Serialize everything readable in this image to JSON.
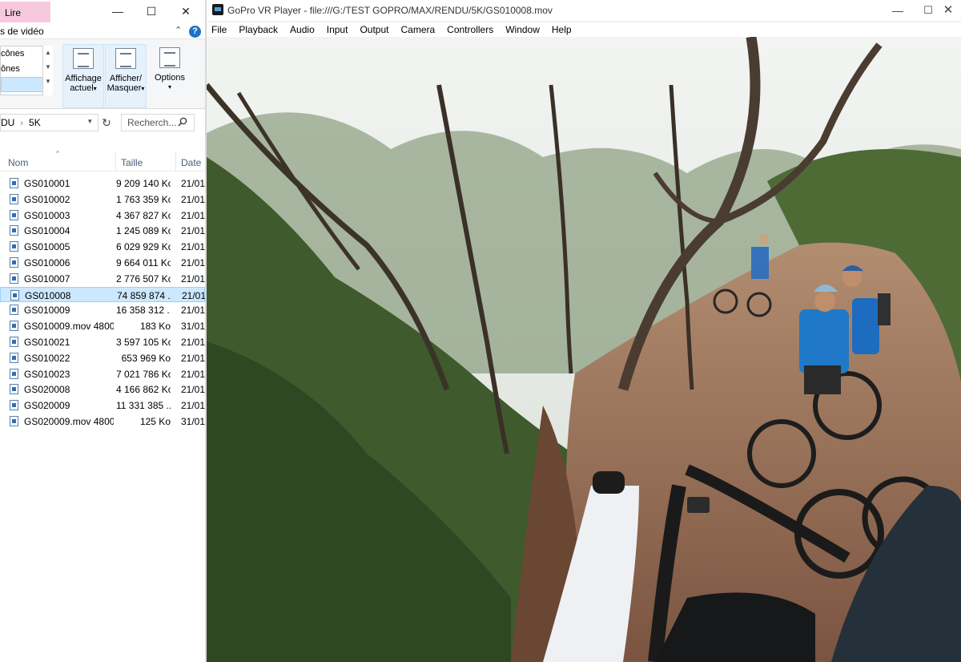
{
  "explorer": {
    "ribbon_tab": "Lire",
    "subtab_label": "s de vidéo",
    "window_controls": {
      "minimize": "—",
      "maximize": "☐",
      "close": "✕"
    },
    "help_glyph": "?",
    "layout_options": [
      "cônes",
      "ônes",
      ""
    ],
    "ribbon_buttons": {
      "affichage_line1": "Affichage",
      "affichage_line2": "actuel",
      "afficher_line1": "Afficher/",
      "afficher_line2": "Masquer",
      "options": "Options"
    },
    "address": {
      "part1": "DU",
      "separator": "›",
      "part2": "5K"
    },
    "search_placeholder": "Recherch...",
    "columns": {
      "name": "Nom",
      "size": "Taille",
      "date": "Date"
    },
    "files": [
      {
        "name": "GS010001",
        "size": "9 209 140 Ko",
        "date": "21/01",
        "selected": false
      },
      {
        "name": "GS010002",
        "size": "1 763 359 Ko",
        "date": "21/01",
        "selected": false
      },
      {
        "name": "GS010003",
        "size": "4 367 827 Ko",
        "date": "21/01",
        "selected": false
      },
      {
        "name": "GS010004",
        "size": "1 245 089 Ko",
        "date": "21/01",
        "selected": false
      },
      {
        "name": "GS010005",
        "size": "6 029 929 Ko",
        "date": "21/01",
        "selected": false
      },
      {
        "name": "GS010006",
        "size": "9 664 011 Ko",
        "date": "21/01",
        "selected": false
      },
      {
        "name": "GS010007",
        "size": "2 776 507 Ko",
        "date": "21/01",
        "selected": false
      },
      {
        "name": "GS010008",
        "size": "74 859 874 ...",
        "date": "21/01",
        "selected": true
      },
      {
        "name": "GS010009",
        "size": "16 358 312 ...",
        "date": "21/01",
        "selected": false
      },
      {
        "name": "GS010009.mov 4800...",
        "size": "183 Ko",
        "date": "31/01",
        "selected": false
      },
      {
        "name": "GS010021",
        "size": "3 597 105 Ko",
        "date": "21/01",
        "selected": false
      },
      {
        "name": "GS010022",
        "size": "653 969 Ko",
        "date": "21/01",
        "selected": false
      },
      {
        "name": "GS010023",
        "size": "7 021 786 Ko",
        "date": "21/01",
        "selected": false
      },
      {
        "name": "GS020008",
        "size": "4 166 862 Ko",
        "date": "21/01",
        "selected": false
      },
      {
        "name": "GS020009",
        "size": "11 331 385 ...",
        "date": "21/01",
        "selected": false
      },
      {
        "name": "GS020009.mov 4800...",
        "size": "125 Ko",
        "date": "31/01",
        "selected": false
      }
    ]
  },
  "player": {
    "title": "GoPro VR Player - file:///G:/TEST GOPRO/MAX/RENDU/5K/GS010008.mov",
    "window_controls": {
      "minimize": "—",
      "maximize": "☐",
      "close": "✕"
    },
    "menu": [
      "File",
      "Playback",
      "Audio",
      "Input",
      "Output",
      "Camera",
      "Controllers",
      "Window",
      "Help"
    ]
  },
  "colors": {
    "ribbon_tab_pink": "#f7c9dd",
    "selection_blue": "#cce8ff",
    "help_blue": "#1a73c9",
    "foliage": "#3f5a2c",
    "trail": "#8a6248"
  }
}
